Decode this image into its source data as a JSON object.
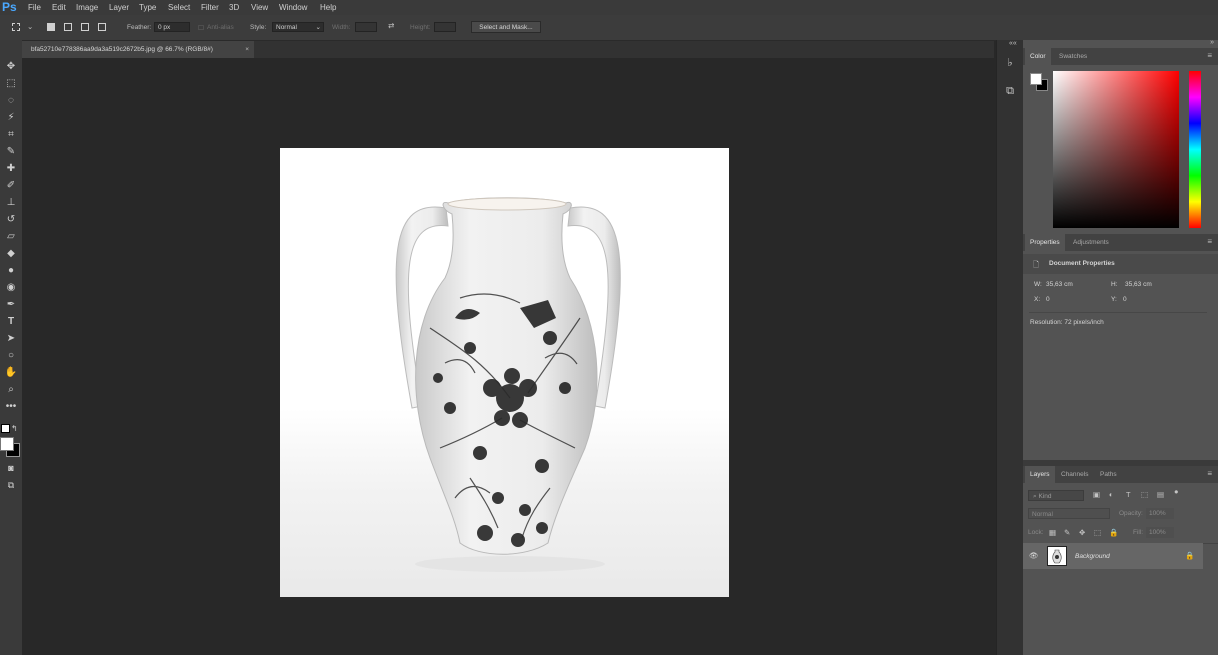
{
  "app": {
    "logo": "Ps"
  },
  "menu": [
    "File",
    "Edit",
    "Image",
    "Layer",
    "Type",
    "Select",
    "Filter",
    "3D",
    "View",
    "Window",
    "Help"
  ],
  "options": {
    "feather_label": "Feather:",
    "feather_value": "0 px",
    "antialias_label": "Anti-alias",
    "style_label": "Style:",
    "style_value": "Normal",
    "width_label": "Width:",
    "height_label": "Height:",
    "select_mask_button": "Select and Mask..."
  },
  "document_tab": {
    "title": "bfa52710e778386aa9da3a519c2672b5.jpg @ 66.7% (RGB/8#)",
    "close": "×"
  },
  "color_panel": {
    "tabs": [
      "Color",
      "Swatches"
    ],
    "active_tab": "Color",
    "hue_colors": "#ff0000"
  },
  "properties_panel": {
    "tabs": [
      "Properties",
      "Adjustments"
    ],
    "active_tab": "Properties",
    "section_title": "Document Properties",
    "w_label": "W:",
    "w_value": "35,63 cm",
    "h_label": "H:",
    "h_value": "35,63 cm",
    "x_label": "X:",
    "x_value": "0",
    "y_label": "Y:",
    "y_value": "0",
    "resolution": "Resolution: 72 pixels/inch"
  },
  "layers_panel": {
    "tabs": [
      "Layers",
      "Channels",
      "Paths"
    ],
    "active_tab": "Layers",
    "search_placeholder": "Kind",
    "blend_mode": "Normal",
    "opacity_label": "Opacity:",
    "opacity_value": "100%",
    "lock_label": "Lock:",
    "fill_label": "Fill:",
    "fill_value": "100%",
    "layers": [
      {
        "name": "Background",
        "visible": true,
        "locked": true
      }
    ]
  },
  "colors": {
    "ui_dark": "#282828",
    "panel": "#535353",
    "accent": "#4aa8ff"
  }
}
